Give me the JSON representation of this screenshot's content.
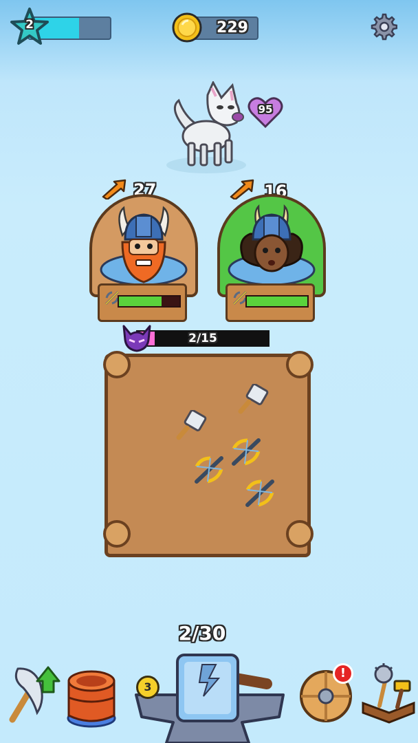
{
  "hud": {
    "level": "2",
    "xp_progress": 0.62,
    "coins": "229",
    "settings_icon": "gear-icon"
  },
  "enemy": {
    "name_icon": "wolf-enemy",
    "health": "95"
  },
  "heroes": [
    {
      "icon": "red-beard-viking",
      "power": "27",
      "health_fraction": 0.7,
      "weapon_icon": "crossbow-icon"
    },
    {
      "icon": "viking-woman",
      "power": "16",
      "health_fraction": 1.0,
      "weapon_icon": "crossbow-icon"
    }
  ],
  "wave": {
    "progress_text": "2/15",
    "progress_fraction": 0.133
  },
  "merge_count": "2/30",
  "forge": {
    "badge_count": "3"
  },
  "colors": {
    "accent_cyan": "#2ed3e8",
    "health_green": "#5ad23c",
    "wave_pink": "#ff6fd6"
  }
}
